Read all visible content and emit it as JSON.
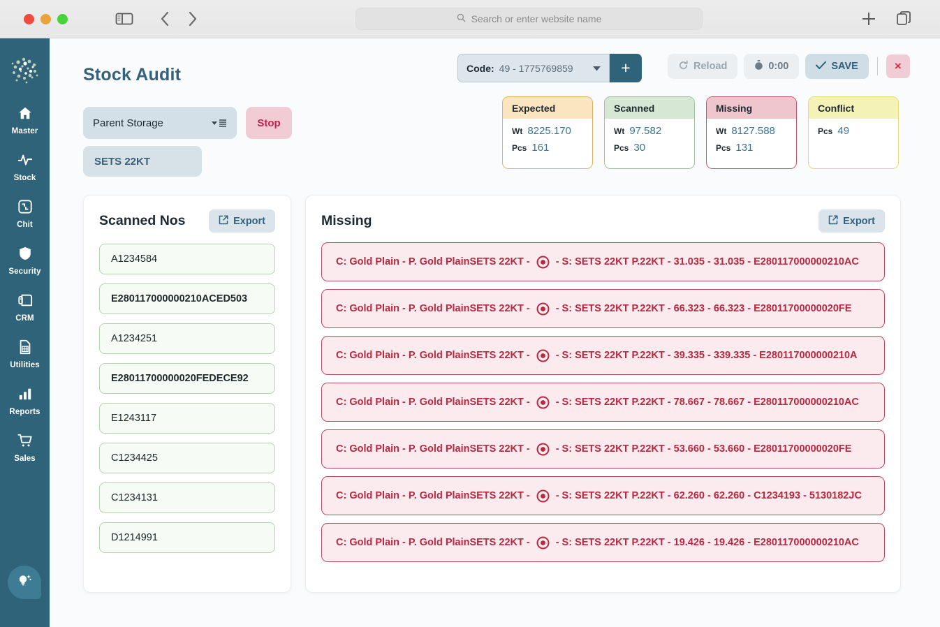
{
  "browser": {
    "address_placeholder": "Search or enter website name",
    "icons": {
      "sidebar_toggle": "sidebar-toggle-icon",
      "back": "back-arrow-icon",
      "forward": "forward-arrow-icon",
      "search": "search-icon",
      "new_tab": "plus-icon",
      "tab_overview": "tab-overview-icon"
    }
  },
  "sidebar": {
    "logo": "brain-logo",
    "items": [
      {
        "label": "Master",
        "icon": "home-icon"
      },
      {
        "label": "Stock",
        "icon": "pulse-icon"
      },
      {
        "label": "Chit",
        "icon": "frame-icon"
      },
      {
        "label": "Security",
        "icon": "shield-icon"
      },
      {
        "label": "CRM",
        "icon": "contact-card-icon"
      },
      {
        "label": "Utilities",
        "icon": "grid-document-icon"
      },
      {
        "label": "Reports",
        "icon": "bar-chart-icon"
      },
      {
        "label": "Sales",
        "icon": "shopping-cart-icon"
      }
    ],
    "fab_icon": "lightbulb-idea-icon"
  },
  "header": {
    "title": "Stock Audit",
    "storage_select": {
      "value": "Parent Storage",
      "icon": "list-dropdown-icon"
    },
    "stop_label": "Stop",
    "kt_chip": "SETS 22KT",
    "code": {
      "label": "Code:",
      "value": "49 - 1775769859",
      "caret_icon": "chevron-down-icon",
      "add_icon": "plus-icon"
    },
    "toolbar": {
      "reload_label": "Reload",
      "reload_icon": "refresh-icon",
      "timer_label": "0:00",
      "timer_icon": "stopwatch-icon",
      "save_label": "SAVE",
      "save_icon": "check-icon",
      "close_label": "×",
      "close_icon": "close-icon"
    }
  },
  "stats": [
    {
      "name": "expected",
      "title": "Expected",
      "rows": [
        {
          "key": "Wt",
          "value": "8225.170"
        },
        {
          "key": "Pcs",
          "value": "161"
        }
      ]
    },
    {
      "name": "scanned",
      "title": "Scanned",
      "rows": [
        {
          "key": "Wt",
          "value": "97.582"
        },
        {
          "key": "Pcs",
          "value": "30"
        }
      ]
    },
    {
      "name": "missing",
      "title": "Missing",
      "rows": [
        {
          "key": "Wt",
          "value": "8127.588"
        },
        {
          "key": "Pcs",
          "value": "131"
        }
      ]
    },
    {
      "name": "conflict",
      "title": "Conflict",
      "rows": [
        {
          "key": "Pcs",
          "value": "49"
        }
      ]
    }
  ],
  "scanned_panel": {
    "title": "Scanned Nos",
    "export_label": "Export",
    "export_icon": "external-link-icon",
    "items": [
      {
        "code": "A1234584",
        "bold": false
      },
      {
        "code": "E280117000000210ACED503",
        "bold": true
      },
      {
        "code": "A1234251",
        "bold": false
      },
      {
        "code": "E28011700000020FEDECE92",
        "bold": true
      },
      {
        "code": "E1243117",
        "bold": false
      },
      {
        "code": "C1234425",
        "bold": false
      },
      {
        "code": "C1234131",
        "bold": false
      },
      {
        "code": "D1214991",
        "bold": false
      }
    ]
  },
  "missing_panel": {
    "title": "Missing",
    "export_label": "Export",
    "export_icon": "external-link-icon",
    "row_icon": "bullseye-icon",
    "items": [
      {
        "prefix": "C: Gold Plain - P. Gold PlainSETS 22KT -",
        "suffix": "- S: SETS 22KT  P.22KT - 31.035 - 31.035 - E280117000000210AC"
      },
      {
        "prefix": "C: Gold Plain - P. Gold PlainSETS 22KT -",
        "suffix": "- S: SETS 22KT  P.22KT - 66.323 - 66.323 - E28011700000020FE"
      },
      {
        "prefix": "C: Gold Plain - P. Gold PlainSETS 22KT -",
        "suffix": "- S: SETS 22KT  P.22KT - 39.335 - 339.335 - E280117000000210A"
      },
      {
        "prefix": "C: Gold Plain - P. Gold PlainSETS 22KT -",
        "suffix": "- S: SETS 22KT  P.22KT - 78.667 - 78.667 - E280117000000210AC"
      },
      {
        "prefix": "C: Gold Plain - P. Gold PlainSETS 22KT -",
        "suffix": "- S: SETS 22KT  P.22KT - 53.660 - 53.660 - E28011700000020FE"
      },
      {
        "prefix": "C: Gold Plain - P. Gold PlainSETS 22KT -",
        "suffix": "- S: SETS 22KT  P.22KT - 62.260 - 62.260 - C1234193 - 5130182JC"
      },
      {
        "prefix": "C: Gold Plain - P. Gold PlainSETS 22KT -",
        "suffix": "- S: SETS 22KT  P.22KT - 19.426 - 19.426 - E280117000000210AC"
      }
    ]
  },
  "colors": {
    "sidebar": "#2e6379",
    "accent": "#35627a",
    "danger": "#b82840",
    "expected": "#fae5c0",
    "scanned": "#d6e7d4",
    "missing": "#f0c6ce",
    "conflict": "#f4f2b6"
  }
}
